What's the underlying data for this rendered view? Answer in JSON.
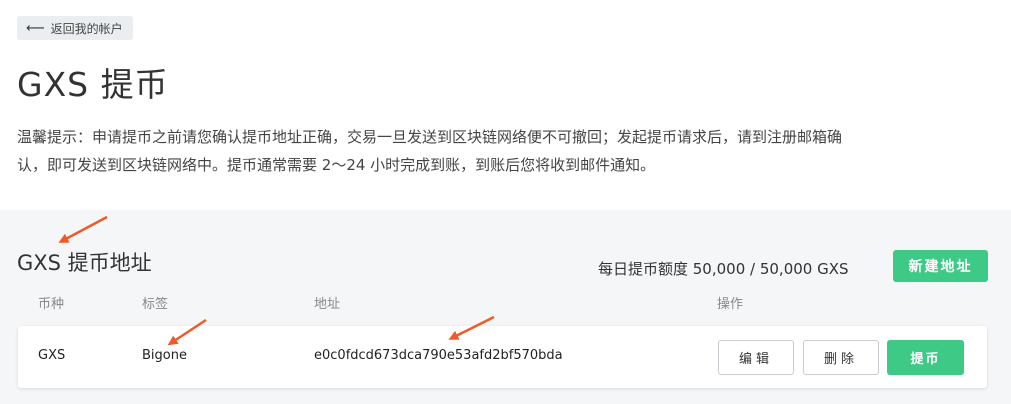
{
  "back_button": {
    "label": "返回我的帐户"
  },
  "page_title": "GXS 提币",
  "notice": {
    "line1": "温馨提示：申请提币之前请您确认提币地址正确，交易一旦发送到区块链网络便不可撤回；发起提币请求后，请到注册邮箱确",
    "line2": "认，即可发送到区块链网络中。提币通常需要 2～24 小时完成到账，到账后您将收到邮件通知。"
  },
  "section": {
    "title": "GXS 提币地址",
    "quota": "每日提币额度 50,000 / 50,000 GXS",
    "new_address_label": "新建地址"
  },
  "table": {
    "headers": [
      "币种",
      "标签",
      "地址",
      "操作"
    ],
    "rows": [
      {
        "currency": "GXS",
        "label": "Bigone",
        "address": "e0c0fdcd673dca790e53afd2bf570bda",
        "actions": {
          "edit": "编辑",
          "delete": "删除",
          "withdraw": "提币"
        }
      }
    ]
  },
  "colors": {
    "accent": "#3fc986",
    "annotation": "#f05a28",
    "panel_bg": "#f5f6f8"
  },
  "icons": {
    "back": "arrow-left-icon"
  }
}
